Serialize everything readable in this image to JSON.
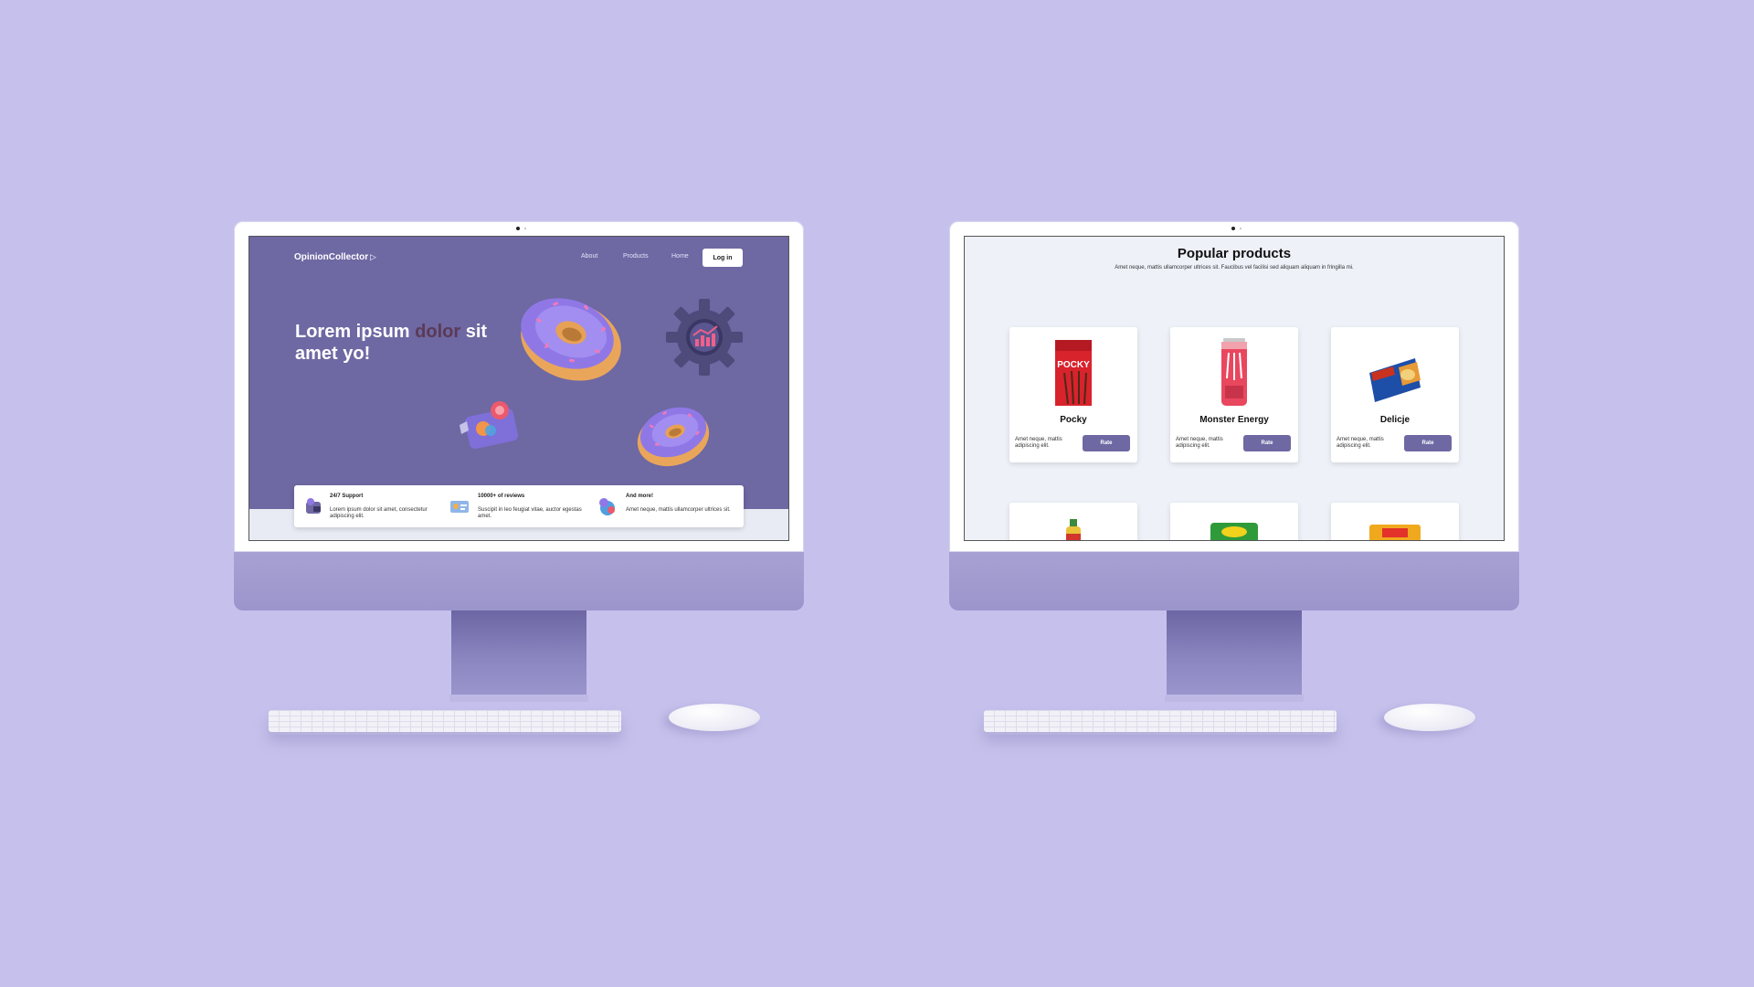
{
  "landing": {
    "logo": "OpinionCollector",
    "nav": [
      "About",
      "Products",
      "Home"
    ],
    "login_label": "Log in",
    "hero": {
      "part1": "Lorem ipsum ",
      "highlight": "dolor",
      "part2": " sit",
      "line2": "amet yo!"
    },
    "features": [
      {
        "title": "24/7 Support",
        "text": "Lorem ipsum dolor sit amet, consectetur adipiscing elit.",
        "icon": "support-icon"
      },
      {
        "title": "10000+ of reviews",
        "text": "Suscipit in leo feugiat vitae, auctor egestas amet.",
        "icon": "reviews-icon"
      },
      {
        "title": "And more!",
        "text": "Amet neque, mattis ullamcorper ultrices sit.",
        "icon": "more-icon"
      }
    ]
  },
  "products_page": {
    "title": "Popular products",
    "subtitle": "Amet neque, mattis ullamcorper ultrices sit. Faucibus vel facilisi sed aliquam aliquam in fringilla mi.",
    "items": [
      {
        "name": "Pocky",
        "desc": "Amet neque, mattis adipiscing elit.",
        "rate": "Rate"
      },
      {
        "name": "Monster Energy",
        "desc": "Amet neque, mattis adipiscing elit.",
        "rate": "Rate"
      },
      {
        "name": "Delicje",
        "desc": "Amet neque, mattis adipiscing elit.",
        "rate": "Rate"
      }
    ]
  },
  "colors": {
    "background": "#c6c1ec",
    "brand": "#6e68a3",
    "highlight": "#5b3a57"
  }
}
